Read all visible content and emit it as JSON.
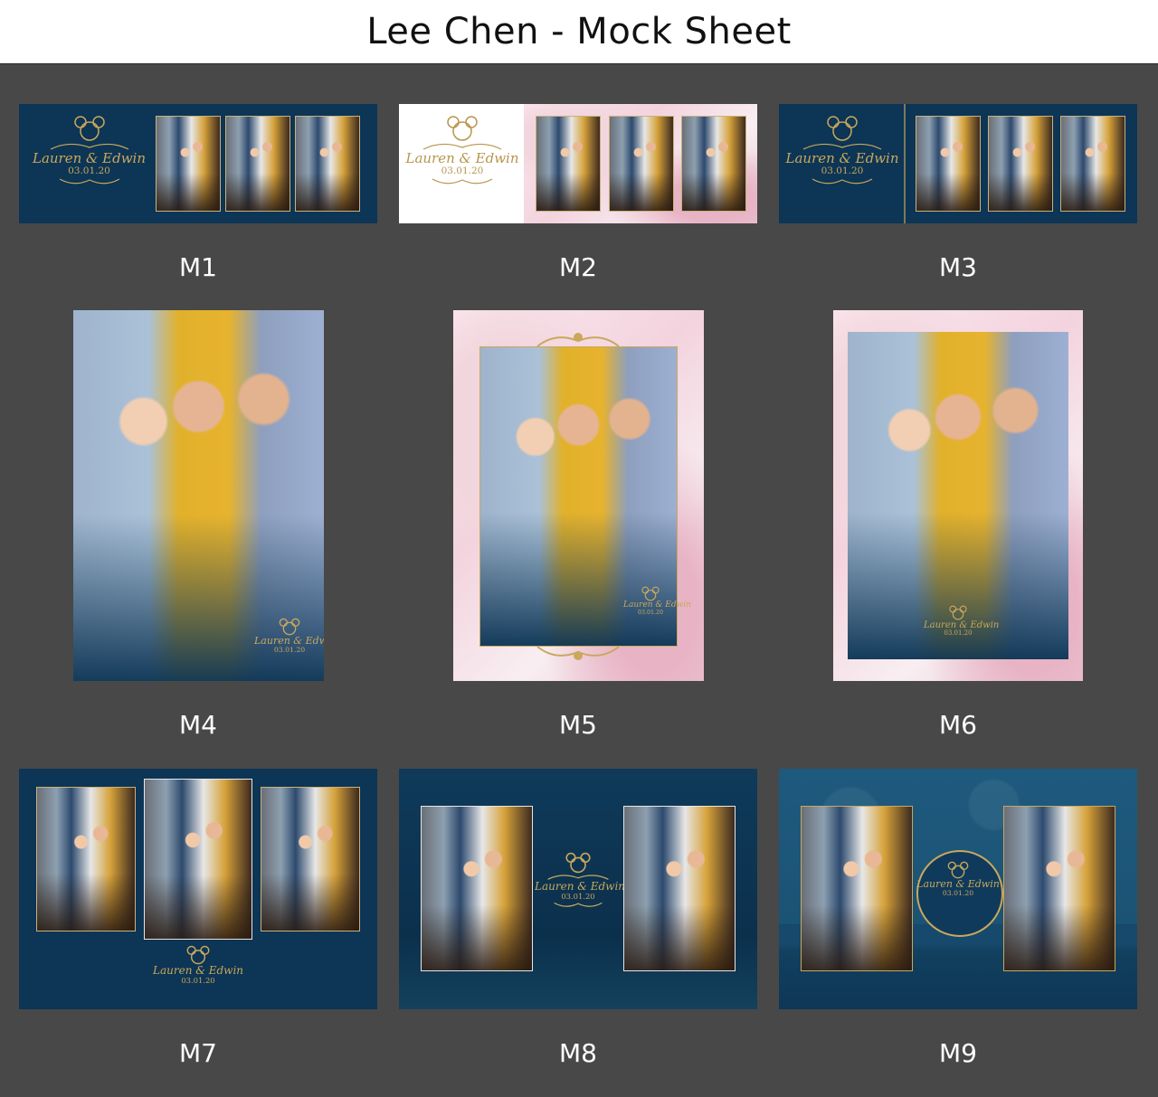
{
  "header": {
    "title": "Lee Chen - Mock Sheet"
  },
  "branding": {
    "names": "Lauren & Edwin",
    "date": "03.01.20",
    "monogram": "LE"
  },
  "colors": {
    "navy": "#0d3555",
    "gold": "#c9a85c",
    "background": "#484848"
  },
  "mocks": [
    {
      "label": "M1"
    },
    {
      "label": "M2"
    },
    {
      "label": "M3"
    },
    {
      "label": "M4"
    },
    {
      "label": "M5"
    },
    {
      "label": "M6"
    },
    {
      "label": "M7"
    },
    {
      "label": "M8"
    },
    {
      "label": "M9"
    }
  ]
}
